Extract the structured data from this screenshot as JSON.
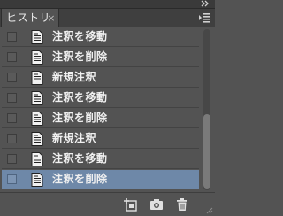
{
  "panel": {
    "tab_label": "ヒストリー",
    "tab_close_glyph": "×",
    "collapse_icon": "double-chevron-right-icon",
    "menu_icon": "panel-menu-icon"
  },
  "history": {
    "items": [
      {
        "label": "注釈を移動",
        "selected": false
      },
      {
        "label": "注釈を削除",
        "selected": false
      },
      {
        "label": "新規注釈",
        "selected": false
      },
      {
        "label": "注釈を移動",
        "selected": false
      },
      {
        "label": "注釈を削除",
        "selected": false
      },
      {
        "label": "新規注釈",
        "selected": false
      },
      {
        "label": "注釈を移動",
        "selected": false
      },
      {
        "label": "注釈を削除",
        "selected": true
      }
    ],
    "item_icon": "document-icon"
  },
  "toolbar": {
    "buttons": [
      "new-document-from-state-icon",
      "camera-icon",
      "trash-icon"
    ]
  },
  "colors": {
    "panel_bg": "#535353",
    "selected_row": "#6e88a8",
    "text": "#f0f0f0"
  }
}
